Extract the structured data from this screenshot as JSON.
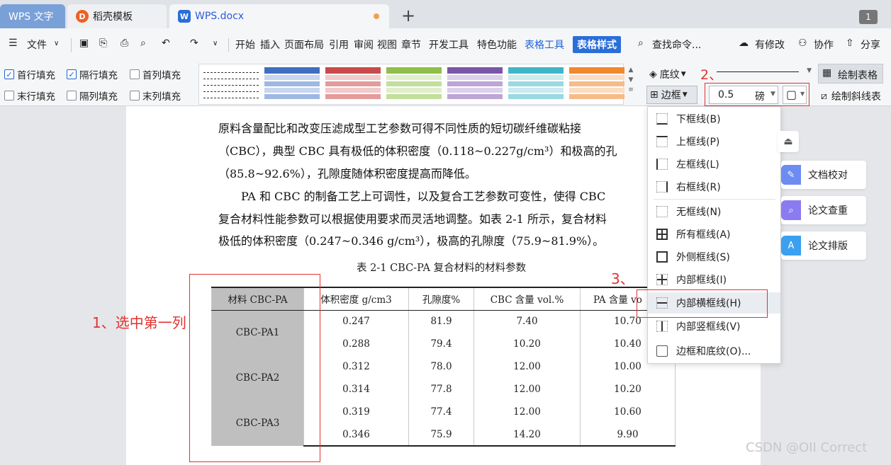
{
  "tabs": [
    {
      "label": "WPS 文字"
    },
    {
      "label": "稻壳模板"
    },
    {
      "label": "WPS.docx"
    }
  ],
  "tabbar": {
    "new_tab": "+",
    "page_count": "1"
  },
  "menu": {
    "file": "文件",
    "items": [
      "开始",
      "插入",
      "页面布局",
      "引用",
      "审阅",
      "视图",
      "章节",
      "开发工具",
      "特色功能",
      "表格工具",
      "表格样式"
    ],
    "search": "查找命令...",
    "revise": "有修改",
    "collab": "协作",
    "share": "分享"
  },
  "table_style_options": {
    "first_row": "首行填充",
    "alt_row": "隔行填充",
    "first_col": "首列填充",
    "last_row": "末行填充",
    "alt_col": "隔列填充",
    "last_col": "末列填充"
  },
  "style_swatches": [
    "#3a4a63",
    "#3f6fc2",
    "#c94a4a",
    "#8fbf4a",
    "#7a55a8",
    "#3fb6c8",
    "#f0882e"
  ],
  "border_controls": {
    "shading": "底纹",
    "border": "边框",
    "width_value": "0.5",
    "width_unit": "磅",
    "draw_table": "绘制表格",
    "draw_diagonal": "绘制斜线表"
  },
  "annotations": {
    "step1": "1、选中第一列",
    "step2": "2、",
    "step3": "3、"
  },
  "document": {
    "lines": [
      "原料含量配比和改变压滤成型工艺参数可得不同性质的短切碳纤维碳粘接",
      "（CBC），典型 CBC 具有极低的体积密度（0.118~0.227g/cm³）和极高的孔",
      "（85.8~92.6%），孔隙度随体积密度提高而降低。",
      "　　PA 和 CBC 的制备工艺上可调性，以及复合工艺参数可变性，使得 CBC",
      "复合材料性能参数可以根据使用要求而灵活地调整。如表 2-1 所示，复合材料",
      "极低的体积密度（0.247~0.346 g/cm³），极高的孔隙度（75.9~81.9%）。"
    ],
    "caption": "表 2-1 CBC-PA 复合材料的材料参数"
  },
  "table": {
    "headers": [
      "材料 CBC-PA",
      "体积密度 g/cm3",
      "孔隙度%",
      "CBC 含量 vol.%",
      "PA 含量 vo"
    ],
    "groups": [
      {
        "name": "CBC-PA1",
        "rows": [
          [
            "0.247",
            "81.9",
            "7.40",
            "10.70"
          ],
          [
            "0.288",
            "79.4",
            "10.20",
            "10.40"
          ]
        ]
      },
      {
        "name": "CBC-PA2",
        "rows": [
          [
            "0.312",
            "78.0",
            "12.00",
            "10.00"
          ],
          [
            "0.314",
            "77.8",
            "12.00",
            "10.20"
          ]
        ]
      },
      {
        "name": "CBC-PA3",
        "rows": [
          [
            "0.319",
            "77.4",
            "12.00",
            "10.60"
          ],
          [
            "0.346",
            "75.9",
            "14.20",
            "9.90"
          ]
        ]
      }
    ]
  },
  "border_menu": [
    {
      "label": "下框线(B)"
    },
    {
      "label": "上框线(P)"
    },
    {
      "label": "左框线(L)"
    },
    {
      "label": "右框线(R)"
    },
    {
      "label": "无框线(N)"
    },
    {
      "label": "所有框线(A)"
    },
    {
      "label": "外侧框线(S)"
    },
    {
      "label": "内部框线(I)"
    },
    {
      "label": "内部横框线(H)"
    },
    {
      "label": "内部竖框线(V)"
    },
    {
      "label": "边框和底纹(O)..."
    }
  ],
  "side_panel": {
    "proofread": "文档校对",
    "plagiarism": "论文查重",
    "layout": "论文排版"
  },
  "watermark": "CSDN @OII Correct"
}
